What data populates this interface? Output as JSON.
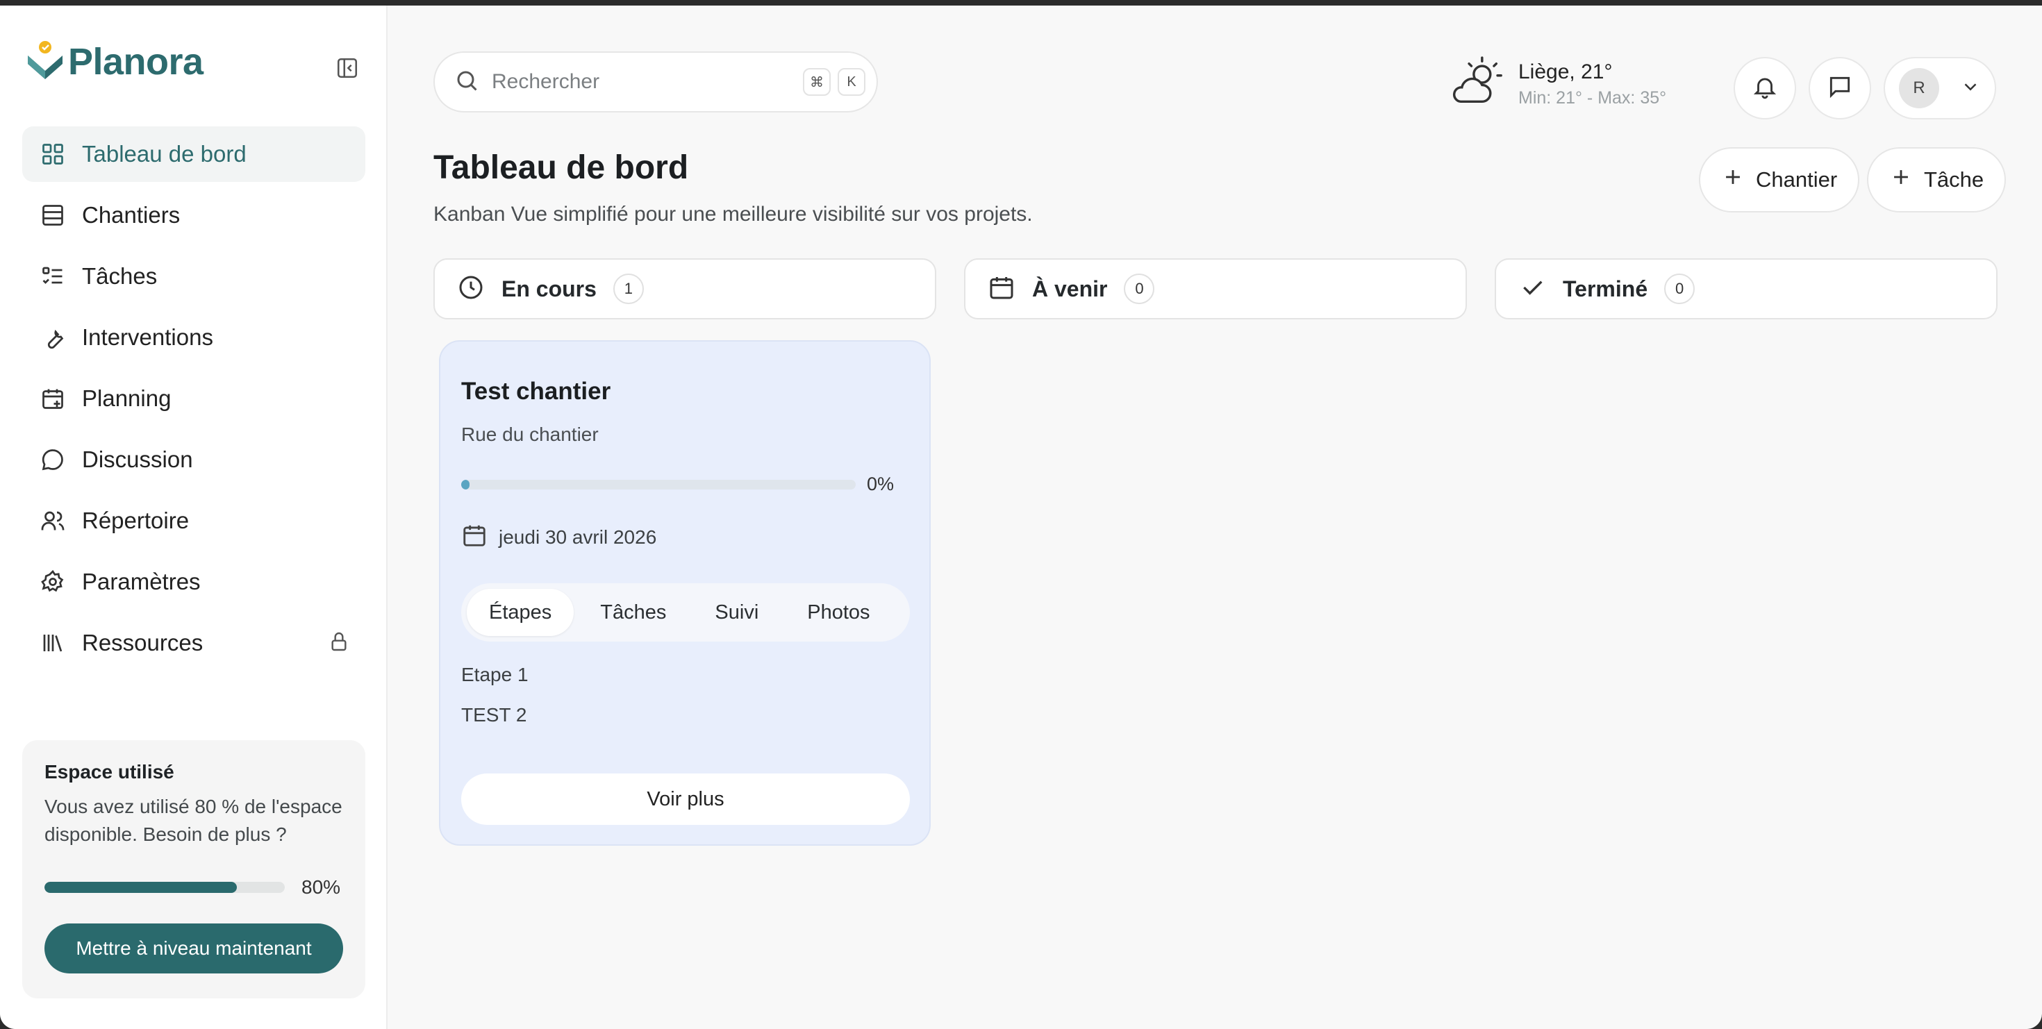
{
  "app": {
    "name": "Planora",
    "brand_color": "#2d6b6e"
  },
  "sidebar": {
    "items": [
      {
        "label": "Tableau de bord",
        "icon": "grid-icon",
        "active": true
      },
      {
        "label": "Chantiers",
        "icon": "layers-icon"
      },
      {
        "label": "Tâches",
        "icon": "checklist-icon"
      },
      {
        "label": "Interventions",
        "icon": "wrench-icon"
      },
      {
        "label": "Planning",
        "icon": "calendar-plus-icon"
      },
      {
        "label": "Discussion",
        "icon": "chat-bubble-icon"
      },
      {
        "label": "Répertoire",
        "icon": "users-icon"
      },
      {
        "label": "Paramètres",
        "icon": "gear-icon"
      },
      {
        "label": "Ressources",
        "icon": "library-icon",
        "locked": true
      }
    ],
    "storage": {
      "title": "Espace utilisé",
      "description": "Vous avez utilisé 80 % de l'espace disponible. Besoin de plus ?",
      "percent": 80,
      "percent_label": "80%",
      "upgrade_label": "Mettre à niveau maintenant"
    }
  },
  "topbar": {
    "search_placeholder": "Rechercher",
    "shortcut_keys": [
      "⌘",
      "K"
    ],
    "weather": {
      "city": "Liège, 21°",
      "minmax": "Min: 21° - Max: 35°"
    },
    "user_initial": "R"
  },
  "header": {
    "title": "Tableau de bord",
    "subtitle": "Kanban Vue simplifié pour une meilleure visibilité sur vos projets.",
    "add_chantier_label": "Chantier",
    "add_task_label": "Tâche"
  },
  "columns": [
    {
      "title": "En cours",
      "count": "1"
    },
    {
      "title": "À venir",
      "count": "0"
    },
    {
      "title": "Terminé",
      "count": "0"
    }
  ],
  "card": {
    "title": "Test chantier",
    "address": "Rue du chantier",
    "progress_percent": 0,
    "progress_label": "0%",
    "date": "jeudi 30 avril 2026",
    "tabs": [
      "Étapes",
      "Tâches",
      "Suivi",
      "Photos"
    ],
    "active_tab": "Étapes",
    "steps": [
      "Etape 1",
      "TEST 2"
    ],
    "more_label": "Voir plus"
  }
}
